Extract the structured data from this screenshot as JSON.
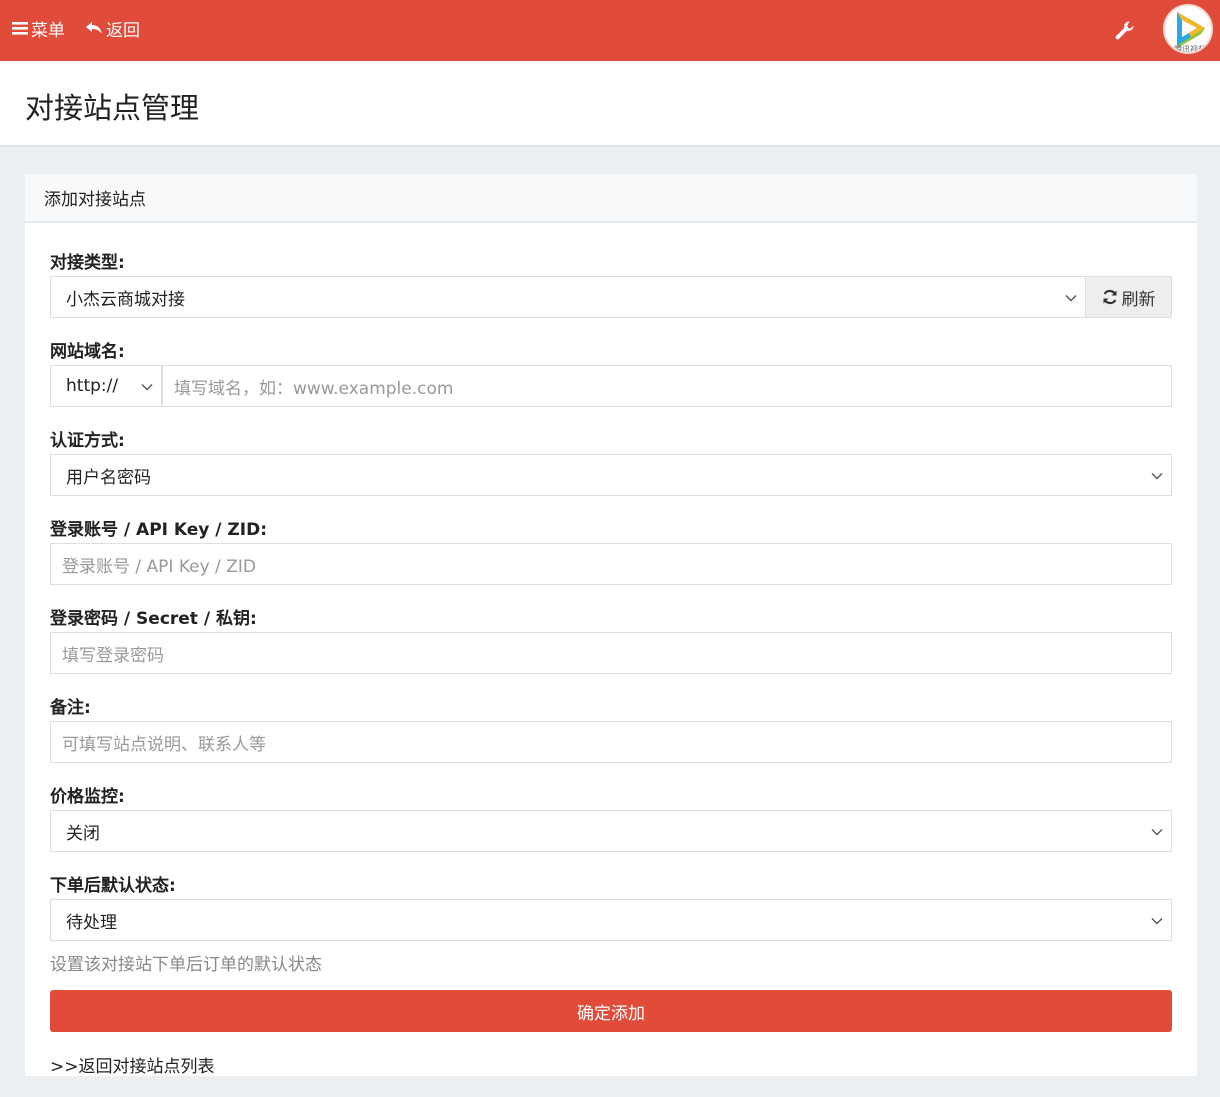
{
  "topbar": {
    "menu_label": "菜单",
    "back_label": "返回",
    "avatar_text": "腾讯视频",
    "colors": {
      "accent": "#e04b3a"
    }
  },
  "page": {
    "title": "对接站点管理"
  },
  "card": {
    "title": "添加对接站点",
    "fields": {
      "type": {
        "label": "对接类型:",
        "value": "小杰云商城对接",
        "refresh_label": "刷新"
      },
      "domain": {
        "label": "网站域名:",
        "protocol": "http://",
        "placeholder": "填写域名，如：www.example.com"
      },
      "auth": {
        "label": "认证方式:",
        "value": "用户名密码"
      },
      "account": {
        "label": "登录账号 / API Key / ZID:",
        "placeholder": "登录账号 / API Key / ZID"
      },
      "password": {
        "label": "登录密码 / Secret / 私钥:",
        "placeholder": "填写登录密码"
      },
      "remark": {
        "label": "备注:",
        "placeholder": "可填写站点说明、联系人等"
      },
      "price_monitor": {
        "label": "价格监控:",
        "value": "关闭"
      },
      "default_status": {
        "label": "下单后默认状态:",
        "value": "待处理",
        "help": "设置该对接站下单后订单的默认状态"
      }
    },
    "submit_label": "确定添加",
    "back_link": ">>返回对接站点列表"
  }
}
